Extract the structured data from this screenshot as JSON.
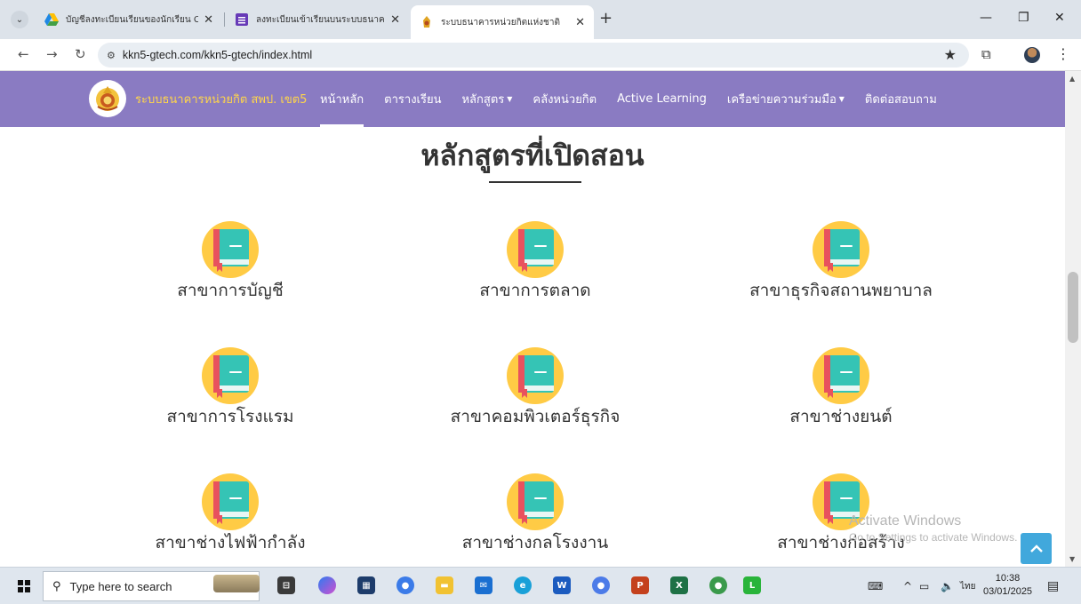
{
  "browser": {
    "tabs": [
      {
        "title": "บัญชีลงทะเบียนเรียนของนักเรียน Cre",
        "active": false
      },
      {
        "title": "ลงทะเบียนเข้าเรียนบนระบบธนาคารฯ",
        "active": false
      },
      {
        "title": "ระบบธนาคารหน่วยกิตแห่งชาติ",
        "active": true
      }
    ],
    "url": "kkn5-gtech.com/kkn5-gtech/index.html"
  },
  "site": {
    "brand": "ระบบธนาคารหน่วยกิต สพป. เขต5",
    "nav": [
      {
        "label": "หน้าหลัก",
        "active": true,
        "dropdown": false
      },
      {
        "label": "ตารางเรียน",
        "active": false,
        "dropdown": false
      },
      {
        "label": "หลักสูตร",
        "active": false,
        "dropdown": true
      },
      {
        "label": "คลังหน่วยกิต",
        "active": false,
        "dropdown": false
      },
      {
        "label": "Active Learning",
        "active": false,
        "dropdown": false
      },
      {
        "label": "เครือข่ายความร่วมมือ",
        "active": false,
        "dropdown": true
      },
      {
        "label": "ติดต่อสอบถาม",
        "active": false,
        "dropdown": false
      }
    ]
  },
  "section": {
    "title": "หลักสูตรที่เปิดสอน"
  },
  "courses": [
    "สาขาการบัญชี",
    "สาขาการตลาด",
    "สาขาธุรกิจสถานพยาบาล",
    "สาขาการโรงแรม",
    "สาขาคอมพิวเตอร์ธุรกิจ",
    "สาขาช่างยนต์",
    "สาขาช่างไฟฟ้ากำลัง",
    "สาขาช่างกลโรงงาน",
    "สาขาช่างก่อสร้าง"
  ],
  "watermark": {
    "line1": "Activate Windows",
    "line2": "Go to Settings to activate Windows."
  },
  "taskbar": {
    "search_placeholder": "Type here to search",
    "language": "ไทย",
    "time": "10:38",
    "date": "03/01/2025"
  },
  "colors": {
    "nav_bg": "#8a7bc2",
    "brand_text": "#ffd54a",
    "icon_circle": "#ffcb45",
    "book_cover": "#35c4b5",
    "book_spine": "#e8525e"
  }
}
